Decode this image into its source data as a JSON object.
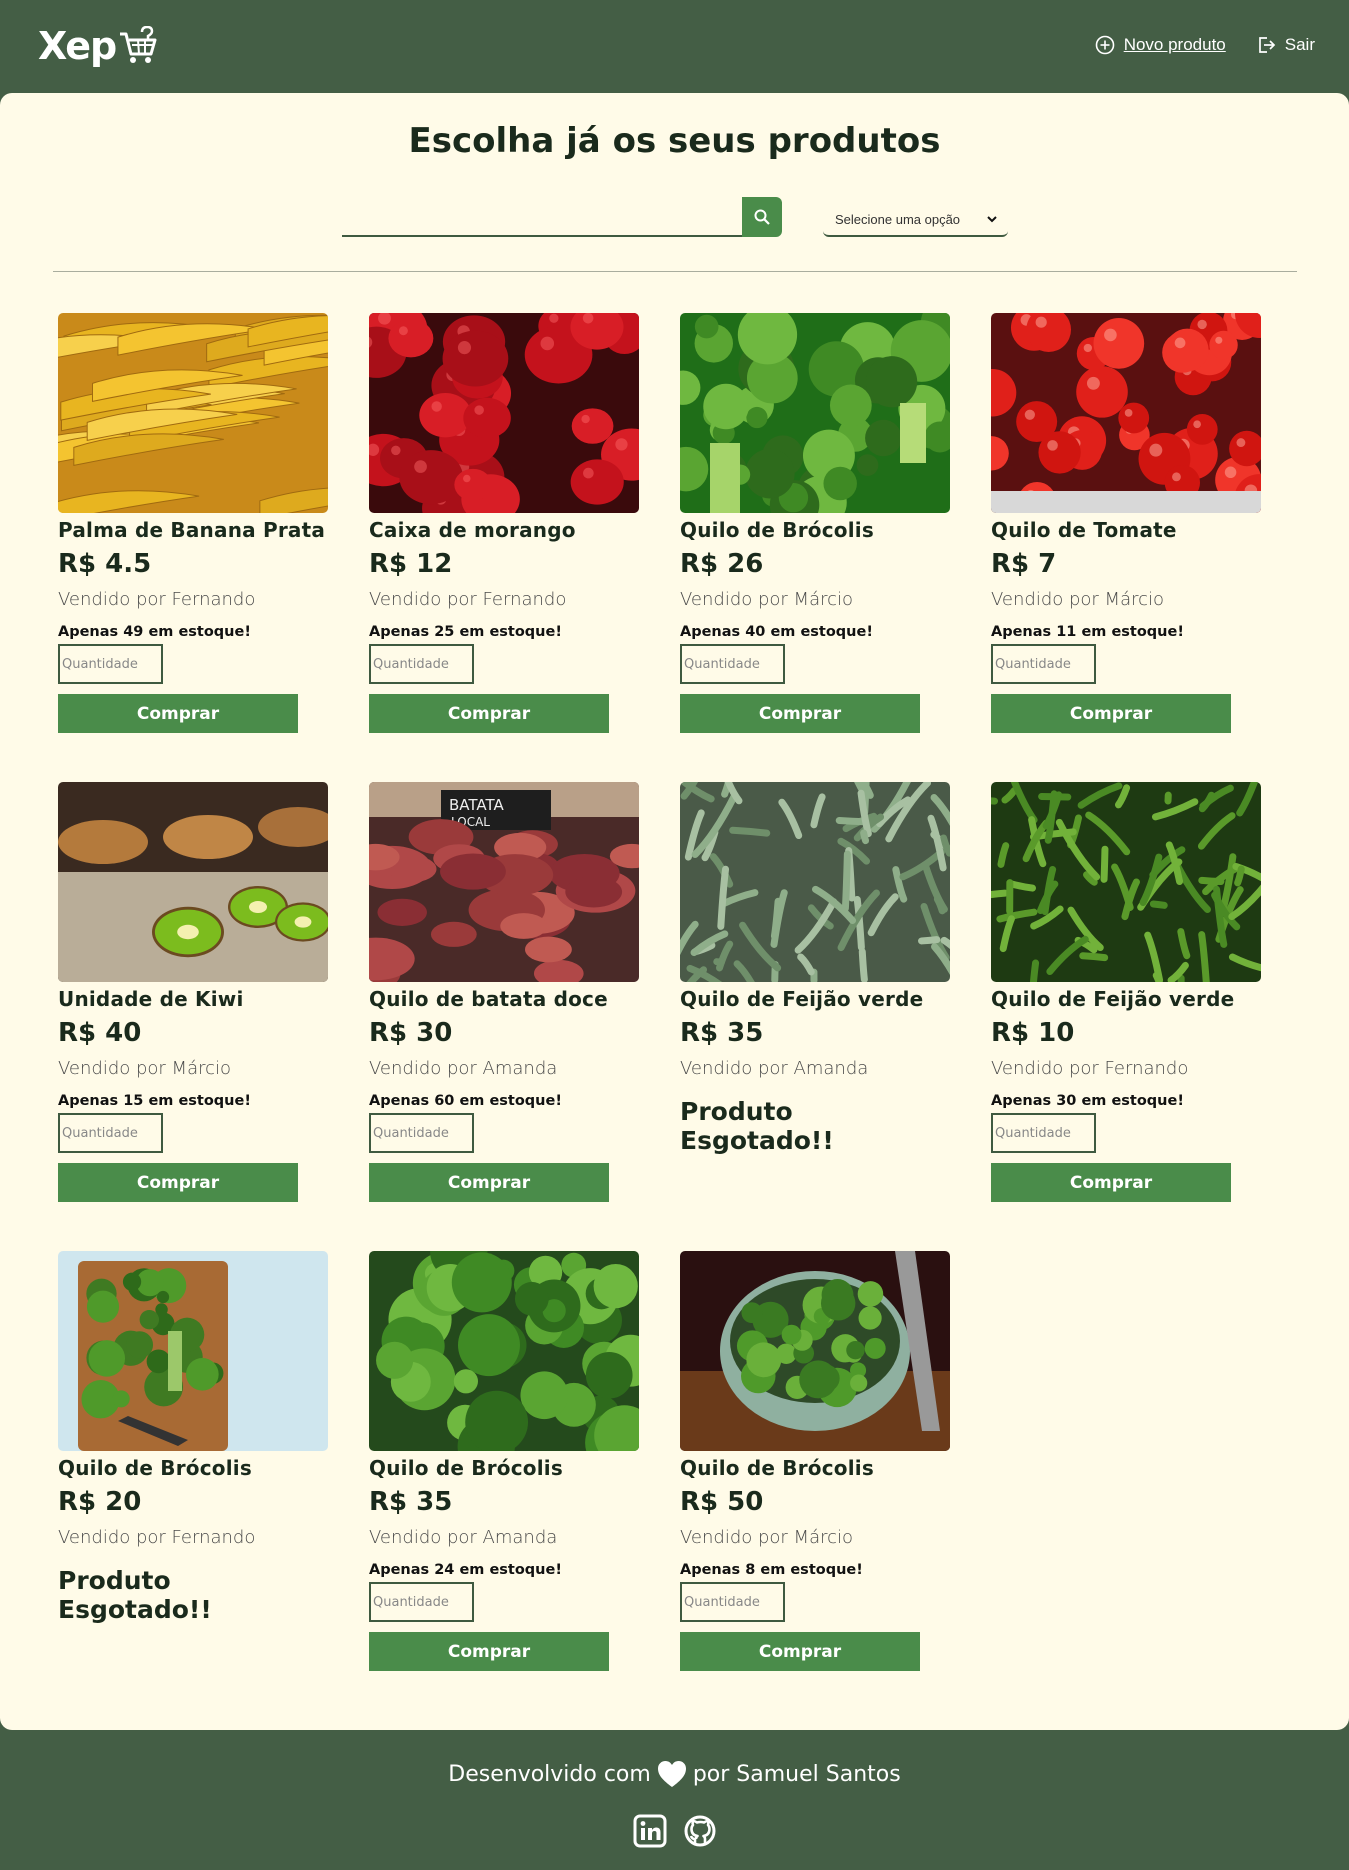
{
  "header": {
    "logo_text": "Xep",
    "new_product_label": "Novo produto",
    "logout_label": "Sair"
  },
  "main": {
    "title": "Escolha já os seus produtos",
    "search_placeholder": "",
    "select_label": "Selecione uma opção"
  },
  "products": [
    {
      "name": "Palma de Banana Prata",
      "price": "R$ 4.5",
      "seller": "Vendido por Fernando",
      "stock": "Apenas 49 em estoque!",
      "soldout": "",
      "image": "bananas"
    },
    {
      "name": "Caixa de morango",
      "price": "R$ 12",
      "seller": "Vendido por Fernando",
      "stock": "Apenas 25 em estoque!",
      "soldout": "",
      "image": "strawberries"
    },
    {
      "name": "Quilo de Brócolis",
      "price": "R$ 26",
      "seller": "Vendido por Márcio",
      "stock": "Apenas 40 em estoque!",
      "soldout": "",
      "image": "broccoli"
    },
    {
      "name": "Quilo de Tomate",
      "price": "R$ 7",
      "seller": "Vendido por Márcio",
      "stock": "Apenas 11 em estoque!",
      "soldout": "",
      "image": "tomatoes"
    },
    {
      "name": "Unidade de Kiwi",
      "price": "R$ 40",
      "seller": "Vendido por Márcio",
      "stock": "Apenas 15 em estoque!",
      "soldout": "",
      "image": "kiwi"
    },
    {
      "name": "Quilo de batata doce",
      "price": "R$ 30",
      "seller": "Vendido por Amanda",
      "stock": "Apenas 60 em estoque!",
      "soldout": "",
      "image": "sweet-potato"
    },
    {
      "name": "Quilo de Feijão verde",
      "price": "R$ 35",
      "seller": "Vendido por Amanda",
      "stock": "",
      "soldout": "Produto Esgotado!!",
      "image": "green-beans-pale"
    },
    {
      "name": "Quilo de Feijão verde",
      "price": "R$ 10",
      "seller": "Vendido por Fernando",
      "stock": "Apenas 30 em estoque!",
      "soldout": "",
      "image": "green-beans"
    },
    {
      "name": "Quilo de Brócolis",
      "price": "R$ 20",
      "seller": "Vendido por Fernando",
      "stock": "",
      "soldout": "Produto Esgotado!!",
      "image": "broccoli-board"
    },
    {
      "name": "Quilo de Brócolis",
      "price": "R$ 35",
      "seller": "Vendido por Amanda",
      "stock": "Apenas 24 em estoque!",
      "soldout": "",
      "image": "broccoli-close"
    },
    {
      "name": "Quilo de Brócolis",
      "price": "R$ 50",
      "seller": "Vendido por Márcio",
      "stock": "Apenas 8 em estoque!",
      "soldout": "",
      "image": "broccoli-bowl"
    }
  ],
  "card_labels": {
    "quantity_placeholder": "Quantidade",
    "buy_label": "Comprar"
  },
  "footer": {
    "text_before": "Desenvolvido com",
    "text_after": "por Samuel Santos"
  },
  "colors": {
    "header_bg": "#445e45",
    "main_bg": "#fffbe8",
    "accent": "#4a8c4a"
  }
}
